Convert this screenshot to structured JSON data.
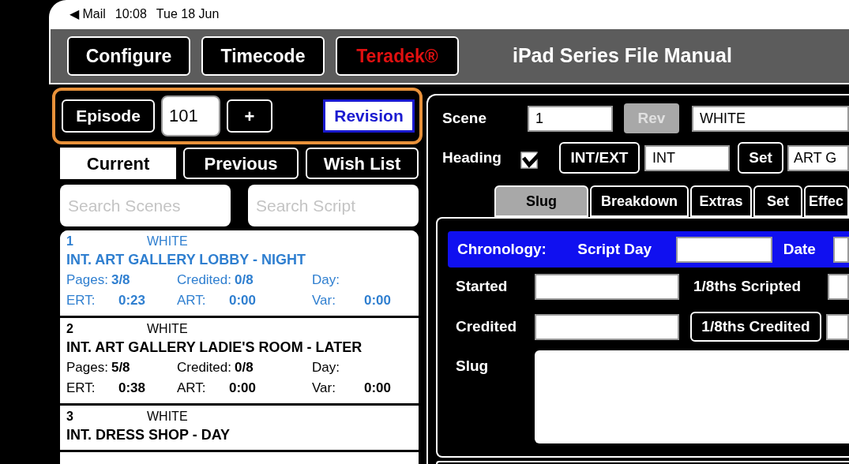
{
  "status_bar": {
    "back": "◀ Mail",
    "time": "10:08",
    "date": "Tue 18 Jun"
  },
  "toolbar": {
    "buttons": [
      {
        "label": "Configure",
        "kind": "plain"
      },
      {
        "label": "Timecode",
        "kind": "plain"
      },
      {
        "label": "Teradek®",
        "kind": "brand"
      }
    ],
    "title": "iPad Series File Manual"
  },
  "episode": {
    "label": "Episode",
    "value": "101",
    "add": "+",
    "revision": "Revision"
  },
  "tabs": [
    {
      "label": "Current",
      "selected": true
    },
    {
      "label": "Previous",
      "selected": false
    },
    {
      "label": "Wish List",
      "selected": false
    }
  ],
  "search": [
    {
      "placeholder": "Search Scenes"
    },
    {
      "placeholder": "Search Script"
    }
  ],
  "scenes": [
    {
      "number": "1",
      "revision": "WHITE",
      "heading": "INT. ART GALLERY LOBBY - NIGHT",
      "selected": true,
      "fields": [
        {
          "label": "Pages:",
          "value": "3/8"
        },
        {
          "label": "Credited:",
          "value": "0/8"
        },
        {
          "label": "Day:"
        },
        {
          "label": "ERT:",
          "value": "0:23"
        },
        {
          "label": "ART:",
          "value": "0:00"
        },
        {
          "label": "Var:",
          "value": "0:00"
        }
      ]
    },
    {
      "number": "2",
      "revision": "WHITE",
      "heading": "INT. ART GALLERY LADIE'S ROOM - LATER",
      "selected": false,
      "fields": [
        {
          "label": "Pages:",
          "value": "5/8"
        },
        {
          "label": "Credited:",
          "value": "0/8"
        },
        {
          "label": "Day:"
        },
        {
          "label": "ERT:",
          "value": "0:38"
        },
        {
          "label": "ART:",
          "value": "0:00"
        },
        {
          "label": "Var:",
          "value": "0:00"
        }
      ]
    },
    {
      "number": "3",
      "revision": "WHITE",
      "heading": "INT. DRESS SHOP - DAY",
      "selected": false
    }
  ],
  "scene": {
    "label": "Scene",
    "value": "1",
    "rev_button": "Rev",
    "rev_disabled": true,
    "rev_value": "WHITE"
  },
  "heading": {
    "label": "Heading",
    "checked": true,
    "int_ext_button": "INT/EXT",
    "int_ext_value": "INT",
    "set_button": "Set",
    "set_value": "ART G"
  },
  "subtabs": [
    {
      "label": "Slug",
      "selected": true
    },
    {
      "label": "Breakdown",
      "selected": false
    },
    {
      "label": "Extras",
      "selected": false
    },
    {
      "label": "Set",
      "selected": false
    },
    {
      "label": "Effec",
      "selected": false
    }
  ],
  "chronology": {
    "label": "Chronology:",
    "script_day_label": "Script Day",
    "date_label": "Date"
  },
  "started": {
    "label": "Started",
    "scripted_label": "1/8ths Scripted"
  },
  "credited": {
    "label": "Credited",
    "button": "1/8ths Credited"
  },
  "slug": {
    "label": "Slug"
  }
}
